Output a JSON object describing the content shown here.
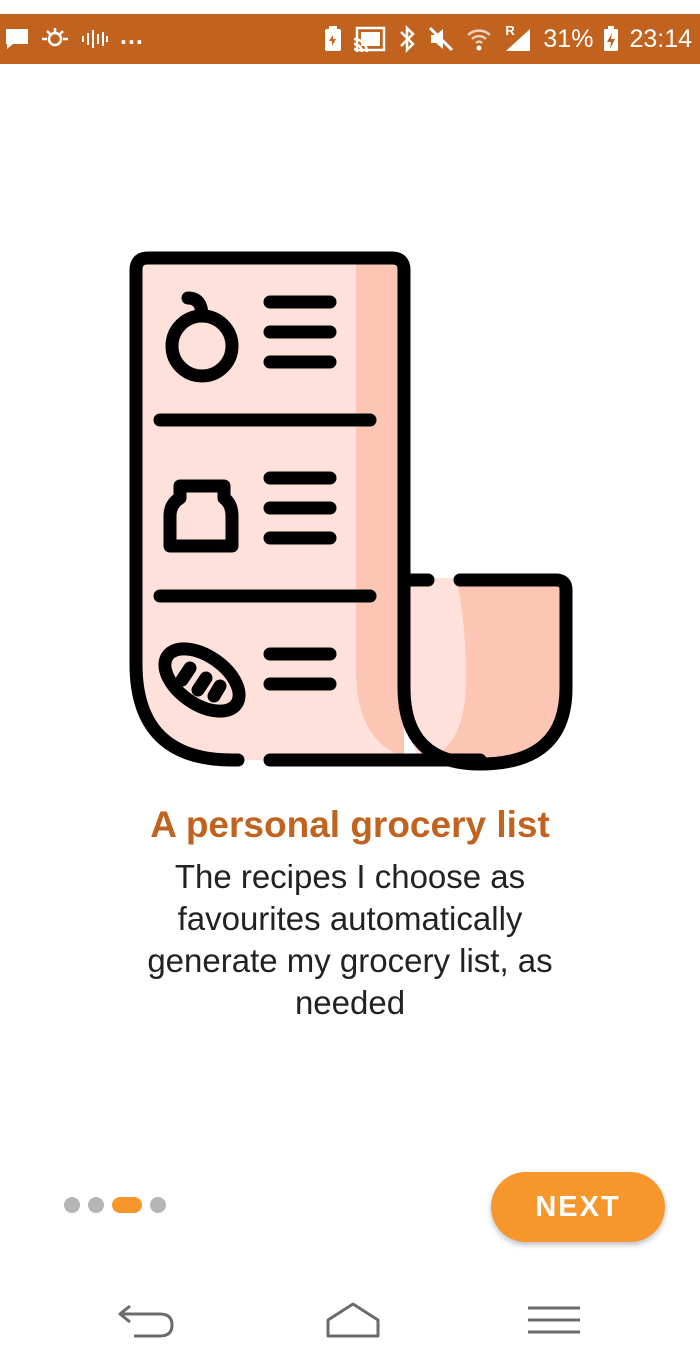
{
  "status_bar": {
    "left_icons": [
      "chat-icon",
      "satellite-icon",
      "voicemail-icon"
    ],
    "overflow": "...",
    "battery_percent": "31%",
    "time": "23:14",
    "right_icons": [
      "battery-saver-icon",
      "cast-icon",
      "bluetooth-icon",
      "mute-icon",
      "wifi-icon",
      "signal-icon",
      "battery-charging-icon"
    ],
    "signal_label": "R"
  },
  "illustration": {
    "name": "grocery-receipt-illustration",
    "fill": "#ffe1dc",
    "shade": "#fcc5b4",
    "stroke": "#000000"
  },
  "onboarding": {
    "title": "A personal grocery list",
    "description": "The recipes I choose as favourites automatically generate my grocery list, as needed",
    "page_count": 4,
    "current_page": 3
  },
  "actions": {
    "next_label": "NEXT"
  },
  "nav_bar": {
    "icons": [
      "back-icon",
      "home-icon",
      "menu-icon"
    ]
  },
  "colors": {
    "accent": "#f7962b",
    "title": "#c1631f",
    "status_bar": "#c1631f"
  }
}
